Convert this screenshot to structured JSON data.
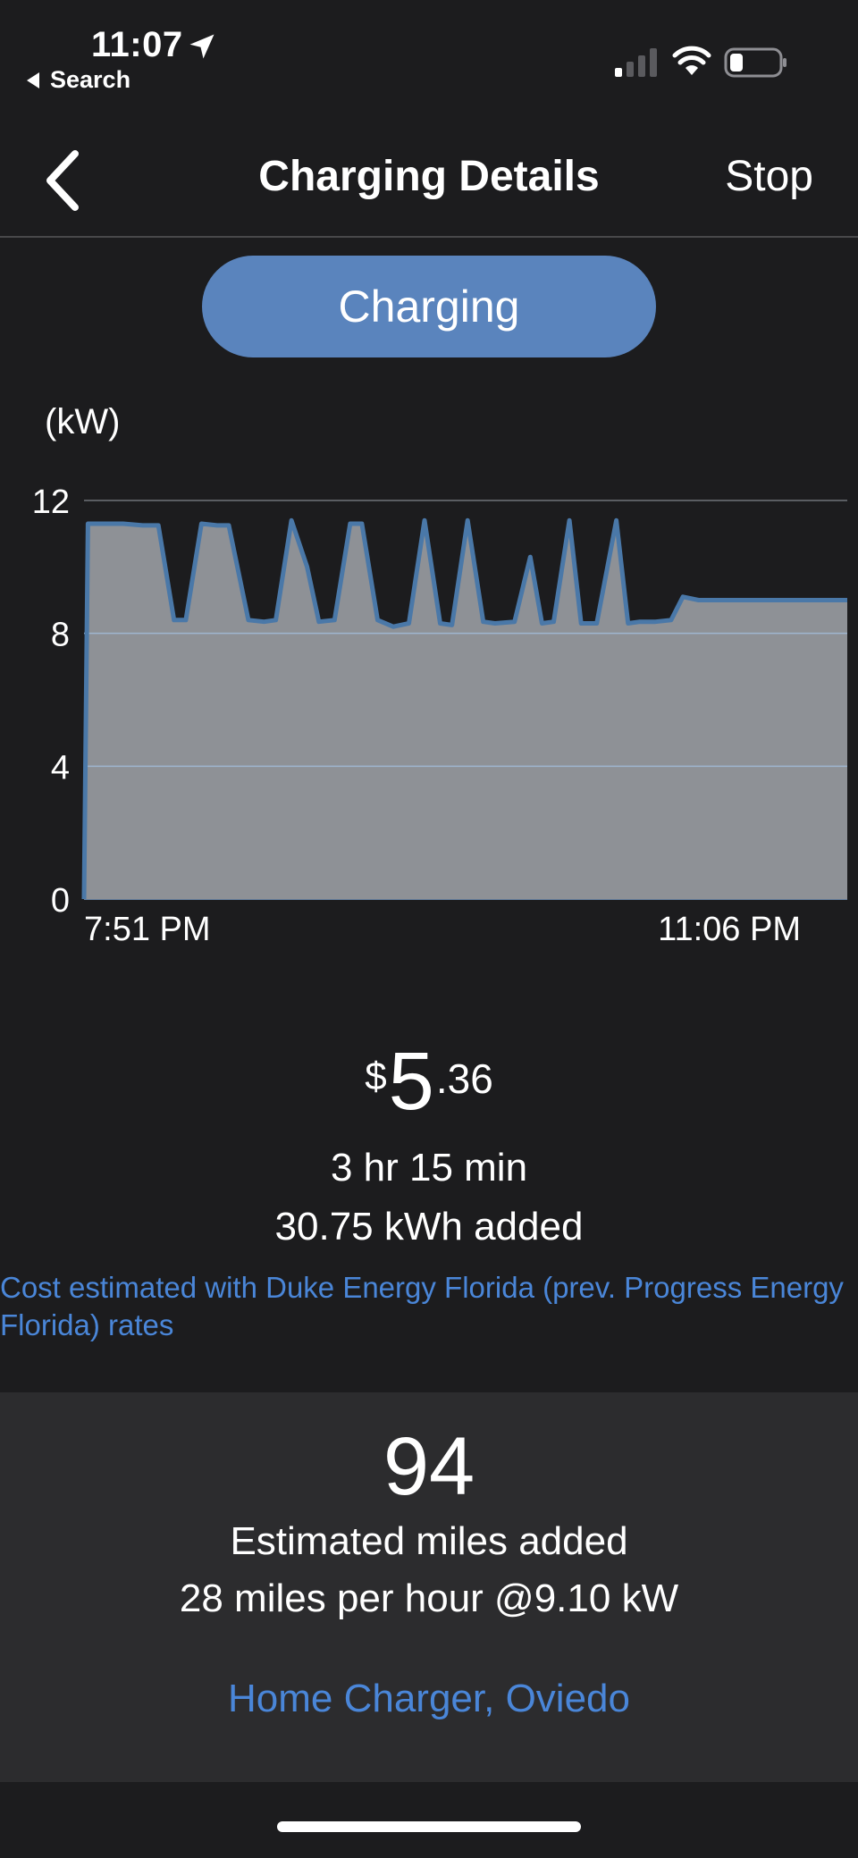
{
  "status_bar": {
    "time": "11:07",
    "back_app": "Search",
    "icons": [
      "location-arrow-icon",
      "cellular-signal-icon",
      "wifi-icon",
      "battery-icon"
    ]
  },
  "nav": {
    "title": "Charging Details",
    "stop_label": "Stop",
    "back_icon": "chevron-left-icon"
  },
  "status_pill": {
    "label": "Charging",
    "color": "#5a84bd"
  },
  "chart_data": {
    "type": "area",
    "title": "",
    "ylabel": "(kW)",
    "xlabel": "",
    "ylim": [
      0,
      12
    ],
    "y_ticks": [
      "0",
      "4",
      "8",
      "12"
    ],
    "x_tick_labels": [
      "7:51 PM",
      "11:06 PM"
    ],
    "grid": true,
    "fill_color": "#8e9196",
    "line_color": "#4a78a8",
    "series": [
      {
        "x_minutes_after_751pm": [
          0,
          1,
          5,
          10,
          15,
          19,
          23,
          26,
          30,
          34,
          37,
          42,
          46,
          49,
          53,
          57,
          60,
          64,
          68,
          71,
          75,
          79,
          83,
          87,
          91,
          94,
          98,
          102,
          105,
          110,
          114,
          117,
          120,
          124,
          127,
          131,
          136,
          139,
          142,
          146,
          150,
          153,
          157,
          162,
          165,
          168,
          172,
          175,
          178,
          182,
          185,
          188,
          191,
          195
        ],
        "kw": [
          0,
          11.3,
          11.3,
          11.3,
          11.25,
          11.25,
          8.4,
          8.4,
          11.3,
          11.25,
          11.25,
          8.4,
          8.35,
          8.4,
          11.4,
          10.0,
          8.35,
          8.4,
          11.3,
          11.3,
          8.4,
          8.2,
          8.3,
          11.4,
          8.3,
          8.25,
          11.4,
          8.35,
          8.3,
          8.35,
          10.3,
          8.3,
          8.35,
          11.4,
          8.3,
          8.3,
          11.4,
          8.3,
          8.35,
          8.35,
          8.4,
          9.1,
          9.0,
          9.0,
          9.0,
          9.0,
          9.0,
          9.0,
          9.0,
          9.0,
          9.0,
          9.0,
          9.0,
          9.0
        ]
      }
    ]
  },
  "summary": {
    "currency": "$",
    "cost_dollars": "5",
    "cost_cents": ".36",
    "duration": "3 hr 15 min",
    "energy_added": "30.75 kWh added",
    "note": "Cost estimated with Duke Energy Florida (prev. Progress Energy Florida) rates"
  },
  "miles": {
    "value": "94",
    "label": "Estimated miles added",
    "rate": "28 miles per hour @9.10 kW",
    "location": "Home Charger, Oviedo"
  },
  "colors": {
    "background": "#1c1c1e",
    "panel": "#2c2c2e",
    "link": "#4a86d8"
  }
}
